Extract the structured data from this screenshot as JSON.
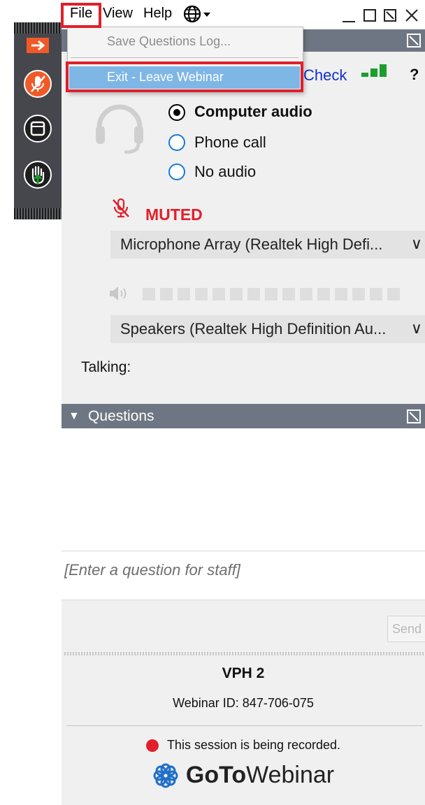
{
  "menu": {
    "file": "File",
    "view": "View",
    "help": "Help",
    "globe_icon": "globe-icon",
    "file_items": [
      {
        "label": "Save Questions Log...",
        "enabled": false
      },
      {
        "label": "Exit - Leave Webinar",
        "enabled": true,
        "highlighted": true
      }
    ]
  },
  "window_controls": [
    "minimize-icon",
    "maximize-icon",
    "restore-icon",
    "close-icon"
  ],
  "audio": {
    "check_label": "Check",
    "help_glyph": "?",
    "options": [
      {
        "label": "Computer audio",
        "selected": true
      },
      {
        "label": "Phone call",
        "selected": false
      },
      {
        "label": "No audio",
        "selected": false
      }
    ],
    "muted_label": "MUTED",
    "microphone": "Microphone Array (Realtek High Defi...",
    "speakers": "Speakers (Realtek High Definition Au...",
    "talking_label": "Talking:",
    "signal_color": "#1a9e2c",
    "muted_color": "#e0202b"
  },
  "questions": {
    "header": "Questions",
    "placeholder": "[Enter a question for staff]",
    "send_label": "Send"
  },
  "info": {
    "webinar_title": "VPH 2",
    "webinar_id": "Webinar ID: 847-706-075",
    "recording_text": "This session is being recorded.",
    "logo_text_bold": "GoTo",
    "logo_text_light": "Webinar"
  },
  "colors": {
    "accent_orange": "#f05a28",
    "header_gray": "#6f7683",
    "highlight_red": "#e0202b",
    "menu_highlight": "#7eb6e6"
  }
}
